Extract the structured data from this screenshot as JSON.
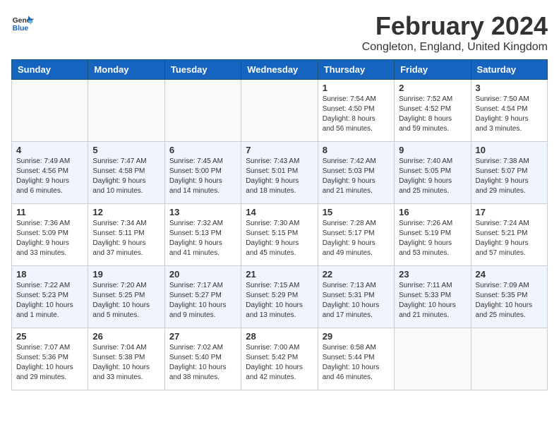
{
  "logo": {
    "text_general": "General",
    "text_blue": "Blue"
  },
  "header": {
    "title": "February 2024",
    "subtitle": "Congleton, England, United Kingdom"
  },
  "days_of_week": [
    "Sunday",
    "Monday",
    "Tuesday",
    "Wednesday",
    "Thursday",
    "Friday",
    "Saturday"
  ],
  "weeks": [
    [
      {
        "day": "",
        "info": ""
      },
      {
        "day": "",
        "info": ""
      },
      {
        "day": "",
        "info": ""
      },
      {
        "day": "",
        "info": ""
      },
      {
        "day": "1",
        "info": "Sunrise: 7:54 AM\nSunset: 4:50 PM\nDaylight: 8 hours\nand 56 minutes."
      },
      {
        "day": "2",
        "info": "Sunrise: 7:52 AM\nSunset: 4:52 PM\nDaylight: 8 hours\nand 59 minutes."
      },
      {
        "day": "3",
        "info": "Sunrise: 7:50 AM\nSunset: 4:54 PM\nDaylight: 9 hours\nand 3 minutes."
      }
    ],
    [
      {
        "day": "4",
        "info": "Sunrise: 7:49 AM\nSunset: 4:56 PM\nDaylight: 9 hours\nand 6 minutes."
      },
      {
        "day": "5",
        "info": "Sunrise: 7:47 AM\nSunset: 4:58 PM\nDaylight: 9 hours\nand 10 minutes."
      },
      {
        "day": "6",
        "info": "Sunrise: 7:45 AM\nSunset: 5:00 PM\nDaylight: 9 hours\nand 14 minutes."
      },
      {
        "day": "7",
        "info": "Sunrise: 7:43 AM\nSunset: 5:01 PM\nDaylight: 9 hours\nand 18 minutes."
      },
      {
        "day": "8",
        "info": "Sunrise: 7:42 AM\nSunset: 5:03 PM\nDaylight: 9 hours\nand 21 minutes."
      },
      {
        "day": "9",
        "info": "Sunrise: 7:40 AM\nSunset: 5:05 PM\nDaylight: 9 hours\nand 25 minutes."
      },
      {
        "day": "10",
        "info": "Sunrise: 7:38 AM\nSunset: 5:07 PM\nDaylight: 9 hours\nand 29 minutes."
      }
    ],
    [
      {
        "day": "11",
        "info": "Sunrise: 7:36 AM\nSunset: 5:09 PM\nDaylight: 9 hours\nand 33 minutes."
      },
      {
        "day": "12",
        "info": "Sunrise: 7:34 AM\nSunset: 5:11 PM\nDaylight: 9 hours\nand 37 minutes."
      },
      {
        "day": "13",
        "info": "Sunrise: 7:32 AM\nSunset: 5:13 PM\nDaylight: 9 hours\nand 41 minutes."
      },
      {
        "day": "14",
        "info": "Sunrise: 7:30 AM\nSunset: 5:15 PM\nDaylight: 9 hours\nand 45 minutes."
      },
      {
        "day": "15",
        "info": "Sunrise: 7:28 AM\nSunset: 5:17 PM\nDaylight: 9 hours\nand 49 minutes."
      },
      {
        "day": "16",
        "info": "Sunrise: 7:26 AM\nSunset: 5:19 PM\nDaylight: 9 hours\nand 53 minutes."
      },
      {
        "day": "17",
        "info": "Sunrise: 7:24 AM\nSunset: 5:21 PM\nDaylight: 9 hours\nand 57 minutes."
      }
    ],
    [
      {
        "day": "18",
        "info": "Sunrise: 7:22 AM\nSunset: 5:23 PM\nDaylight: 10 hours\nand 1 minute."
      },
      {
        "day": "19",
        "info": "Sunrise: 7:20 AM\nSunset: 5:25 PM\nDaylight: 10 hours\nand 5 minutes."
      },
      {
        "day": "20",
        "info": "Sunrise: 7:17 AM\nSunset: 5:27 PM\nDaylight: 10 hours\nand 9 minutes."
      },
      {
        "day": "21",
        "info": "Sunrise: 7:15 AM\nSunset: 5:29 PM\nDaylight: 10 hours\nand 13 minutes."
      },
      {
        "day": "22",
        "info": "Sunrise: 7:13 AM\nSunset: 5:31 PM\nDaylight: 10 hours\nand 17 minutes."
      },
      {
        "day": "23",
        "info": "Sunrise: 7:11 AM\nSunset: 5:33 PM\nDaylight: 10 hours\nand 21 minutes."
      },
      {
        "day": "24",
        "info": "Sunrise: 7:09 AM\nSunset: 5:35 PM\nDaylight: 10 hours\nand 25 minutes."
      }
    ],
    [
      {
        "day": "25",
        "info": "Sunrise: 7:07 AM\nSunset: 5:36 PM\nDaylight: 10 hours\nand 29 minutes."
      },
      {
        "day": "26",
        "info": "Sunrise: 7:04 AM\nSunset: 5:38 PM\nDaylight: 10 hours\nand 33 minutes."
      },
      {
        "day": "27",
        "info": "Sunrise: 7:02 AM\nSunset: 5:40 PM\nDaylight: 10 hours\nand 38 minutes."
      },
      {
        "day": "28",
        "info": "Sunrise: 7:00 AM\nSunset: 5:42 PM\nDaylight: 10 hours\nand 42 minutes."
      },
      {
        "day": "29",
        "info": "Sunrise: 6:58 AM\nSunset: 5:44 PM\nDaylight: 10 hours\nand 46 minutes."
      },
      {
        "day": "",
        "info": ""
      },
      {
        "day": "",
        "info": ""
      }
    ]
  ]
}
